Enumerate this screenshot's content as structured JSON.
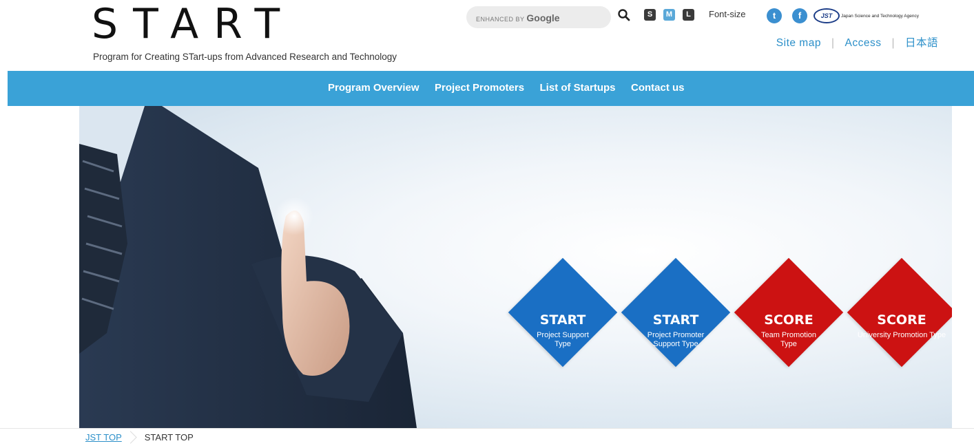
{
  "header": {
    "logo": "START",
    "tagline": "Program for Creating STart-ups from Advanced Research and Technology",
    "search": {
      "prefix": "ENHANCED BY",
      "brand": "Google"
    },
    "font_size": {
      "small": "S",
      "medium": "M",
      "large": "L",
      "label": "Font-size"
    },
    "social": {
      "twitter": "t",
      "facebook": "f"
    },
    "jst": {
      "mark": "JST",
      "name": "Japan Science and Technology Agency"
    },
    "links": {
      "sitemap": "Site map",
      "access": "Access",
      "japanese": "日本語"
    }
  },
  "nav": {
    "items": [
      {
        "label": "Program Overview"
      },
      {
        "label": "Project Promoters"
      },
      {
        "label": "List of Startups"
      },
      {
        "label": "Contact us"
      }
    ]
  },
  "hero": {
    "diamonds": [
      {
        "title": "START",
        "subtitle": "Project Support Type",
        "color": "#1a6fc4"
      },
      {
        "title": "START",
        "subtitle": "Project Promoter Support Type",
        "color": "#1a6fc4"
      },
      {
        "title": "SCORE",
        "subtitle": "Team Promotion Type",
        "color": "#cc1212"
      },
      {
        "title": "SCORE",
        "subtitle": "University Promotion Type",
        "color": "#cc1212"
      }
    ]
  },
  "breadcrumb": {
    "home": "JST TOP",
    "current": "START TOP"
  },
  "colors": {
    "nav": "#3aa2d7",
    "link": "#2b8fc9",
    "blue": "#1a6fc4",
    "red": "#cc1212"
  }
}
